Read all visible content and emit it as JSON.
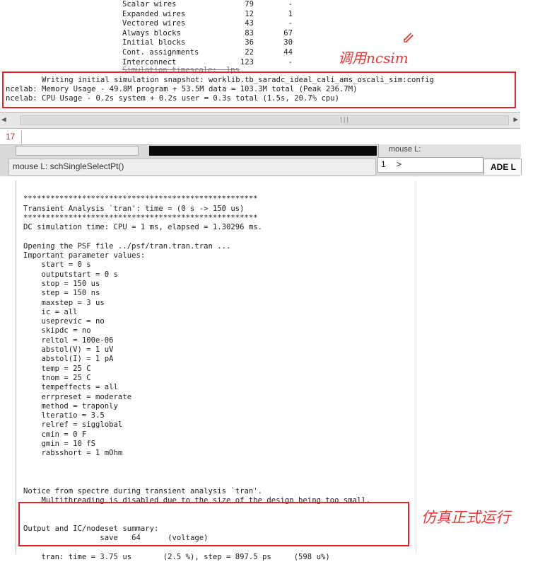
{
  "stats": [
    {
      "label": "Scalar wires",
      "a": "79",
      "b": "-"
    },
    {
      "label": "Expanded wires",
      "a": "12",
      "b": "1"
    },
    {
      "label": "Vectored wires",
      "a": "43",
      "b": "-"
    },
    {
      "label": "Always blocks",
      "a": "83",
      "b": "67"
    },
    {
      "label": "Initial blocks",
      "a": "36",
      "b": "30"
    },
    {
      "label": "Cont. assignments",
      "a": "22",
      "b": "44"
    },
    {
      "label": "Interconnect",
      "a": "123",
      "b": "-"
    }
  ],
  "partial_line": "Simulation timescale:  1ps",
  "ncelab": {
    "snapshot": "        Writing initial simulation snapshot: worklib.tb_saradc_ideal_cali_ams_oscali_sim:config",
    "memory": "ncelab: Memory Usage - 49.8M program + 53.5M data = 103.3M total (Peak 236.7M)",
    "cpu": "ncelab: CPU Usage - 0.2s system + 0.2s user = 0.3s total (1.5s, 20.7% cpu)"
  },
  "annotations": {
    "ncsim": "调用ncsim",
    "formal_run": "仿真正式运行",
    "arrow": "⇙"
  },
  "chrome": {
    "line_number": "17",
    "mouse_top": "mouse L:",
    "status_text": "mouse L: schSingleSelectPt()",
    "cmd_number": "1",
    "cmd_prompt": ">",
    "ade_tab": "ADE L"
  },
  "log_lines": [
    "",
    "****************************************************",
    "Transient Analysis `tran': time = (0 s -> 150 us)",
    "****************************************************",
    "DC simulation time: CPU = 1 ms, elapsed = 1.30296 ms.",
    "",
    "Opening the PSF file ../psf/tran.tran.tran ...",
    "Important parameter values:",
    "    start = 0 s",
    "    outputstart = 0 s",
    "    stop = 150 us",
    "    step = 150 ns",
    "    maxstep = 3 us",
    "    ic = all",
    "    useprevic = no",
    "    skipdc = no",
    "    reltol = 100e-06",
    "    abstol(V) = 1 uV",
    "    abstol(I) = 1 pA",
    "    temp = 25 C",
    "    tnom = 25 C",
    "    tempeffects = all",
    "    errpreset = moderate",
    "    method = traponly",
    "    lteratio = 3.5",
    "    relref = sigglobal",
    "    cmin = 0 F",
    "    gmin = 10 fS",
    "    rabsshort = 1 mOhm",
    "",
    "",
    "",
    "Notice from spectre during transient analysis `tran'.",
    "    Multithreading is disabled due to the size of the design being too small.",
    "",
    "",
    "Output and IC/nodeset summary:",
    "                 save   64      (voltage)",
    "",
    "    tran: time = 3.75 us       (2.5 %), step = 897.5 ps     (598 u%)"
  ]
}
